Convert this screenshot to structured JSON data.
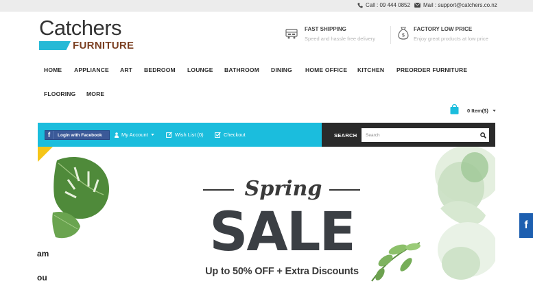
{
  "topbar": {
    "call": "Call : 09 444 0852",
    "mail": "Mail : support@catchers.co.nz"
  },
  "logo": {
    "title": "Catchers",
    "subtitle": "FURNITURE"
  },
  "features": [
    {
      "title": "FAST SHIPPING",
      "subtitle": "Speed and hassle free delivery",
      "icon": "truck-icon"
    },
    {
      "title": "FACTORY LOW PRICE",
      "subtitle": "Enjoy great products at low price",
      "icon": "money-bag-icon"
    }
  ],
  "nav": {
    "items": [
      "HOME",
      "APPLIANCE",
      "ART",
      "BEDROOM",
      "LOUNGE",
      "BATHROOM",
      "DINING",
      "HOME OFFICE",
      "KITCHEN",
      "PREORDER FURNITURE",
      "FLOORING",
      "MORE"
    ]
  },
  "cart": {
    "label": "0 Item($)"
  },
  "toolbar": {
    "facebook_login": "Login with Facebook",
    "my_account": "My Account",
    "wish_list": "Wish List (0)",
    "checkout": "Checkout"
  },
  "search": {
    "label": "SEARCH",
    "placeholder": "Search"
  },
  "banner": {
    "spring": "Spring",
    "sale": "SALE",
    "discount": "Up to 50% OFF + Extra Discounts"
  },
  "edge_text": [
    "am",
    "ou"
  ],
  "social_float": "f",
  "colors": {
    "accent": "#1bbddd",
    "dark": "#2a2a2a",
    "facebook": "#3b5998",
    "brand_brown": "#7a3e20"
  }
}
